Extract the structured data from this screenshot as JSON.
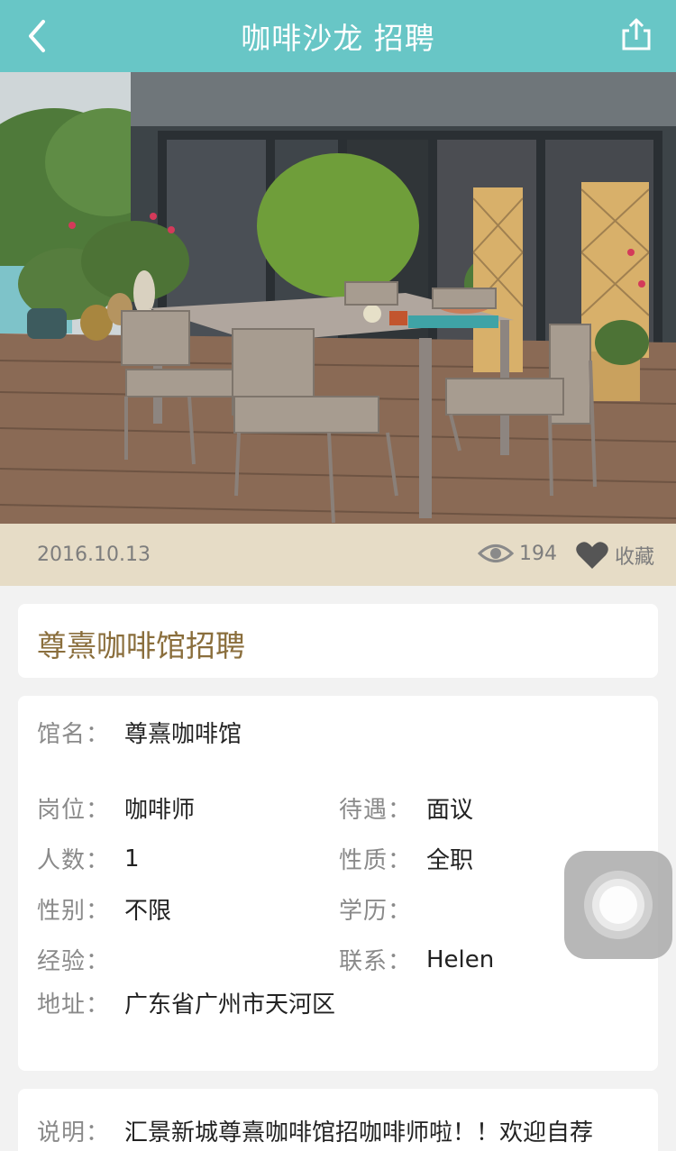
{
  "header": {
    "title": "咖啡沙龙 招聘",
    "back_icon": "chevron-left-icon",
    "share_icon": "share-icon"
  },
  "hero": {
    "image_subject": "photo"
  },
  "meta": {
    "date": "2016.10.13",
    "views": "194",
    "favorite_label": "收藏",
    "view_icon": "eye-icon",
    "favorite_icon": "heart-icon"
  },
  "job": {
    "title": "尊熹咖啡馆招聘"
  },
  "details": {
    "venue_label": "馆名：",
    "venue_value": "尊熹咖啡馆",
    "position_label": "岗位：",
    "position_value": "咖啡师",
    "salary_label": "待遇：",
    "salary_value": "面议",
    "headcount_label": "人数：",
    "headcount_value": "1",
    "type_label": "性质：",
    "type_value": "全职",
    "gender_label": "性别：",
    "gender_value": "不限",
    "education_label": "学历：",
    "education_value": "",
    "experience_label": "经验：",
    "experience_value": "",
    "contact_label": "联系：",
    "contact_value": "Helen",
    "address_label": "地址：",
    "address_value": "广东省广州市天河区"
  },
  "description": {
    "label": "说明：",
    "text": "汇景新城尊熹咖啡馆招咖啡师啦！！欢迎自荐"
  },
  "colors": {
    "accent": "#68c6c6",
    "meta_bar": "#e6dcc6",
    "title_text": "#8a6e3c"
  }
}
